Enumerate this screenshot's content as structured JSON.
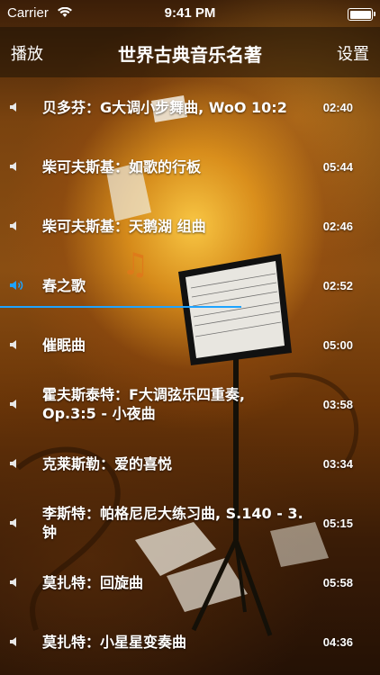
{
  "status_bar": {
    "carrier": "Carrier",
    "time": "9:41 PM"
  },
  "nav": {
    "left": "播放",
    "title": "世界古典音乐名著",
    "right": "设置"
  },
  "accent_color": "#1ea3ff",
  "playing_index": 3,
  "tracks": [
    {
      "title": "贝多芬：G大调小步舞曲, WoO 10:2",
      "duration": "02:40"
    },
    {
      "title": "柴可夫斯基：如歌的行板",
      "duration": "05:44"
    },
    {
      "title": "柴可夫斯基：天鹅湖 组曲",
      "duration": "02:46"
    },
    {
      "title": "春之歌",
      "duration": "02:52"
    },
    {
      "title": "催眠曲",
      "duration": "05:00"
    },
    {
      "title": "霍夫斯泰特：F大调弦乐四重奏, Op.3:5 - 小夜曲",
      "duration": "03:58"
    },
    {
      "title": "克莱斯勒：爱的喜悦",
      "duration": "03:34"
    },
    {
      "title": "李斯特：帕格尼尼大练习曲, S.140 - 3. 钟",
      "duration": "05:15"
    },
    {
      "title": "莫扎特：回旋曲",
      "duration": "05:58"
    },
    {
      "title": "莫扎特：小星星变奏曲",
      "duration": "04:36"
    }
  ]
}
